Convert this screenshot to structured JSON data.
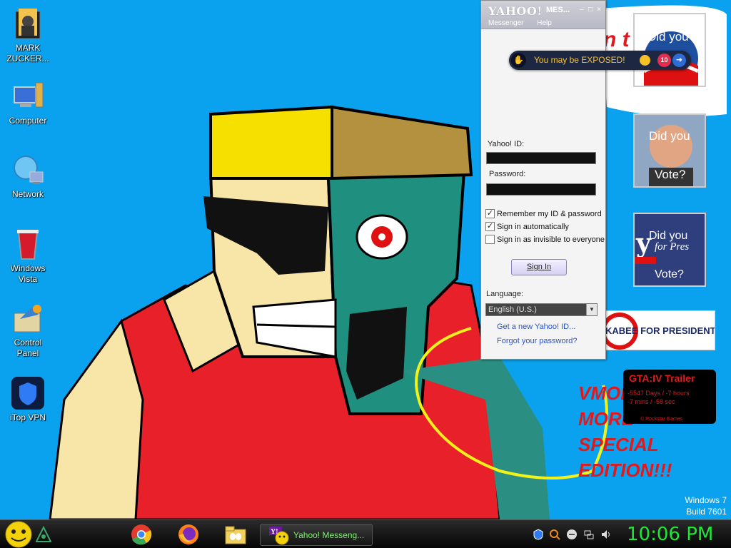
{
  "desktop_icons": [
    {
      "label": "MARK\nZUCKER...",
      "icon": "mark-zuckerberg-folder-icon"
    },
    {
      "label": "Computer",
      "icon": "computer-icon"
    },
    {
      "label": "Network",
      "icon": "network-globe-icon"
    },
    {
      "label": "Windows\nVista",
      "icon": "recycle-bin-icon"
    },
    {
      "label": "Control\nPanel",
      "icon": "control-panel-icon"
    },
    {
      "label": "iTop VPN",
      "icon": "itop-vpn-icon"
    }
  ],
  "gadgets": {
    "speech_fragment": "n t",
    "obama": {
      "text": "Did you"
    },
    "mccain": {
      "line1": "Did you",
      "line2": "Vote?"
    },
    "yahoo_vote": {
      "line1": "Did you",
      "line2": "for Pres",
      "line3": "Vote?"
    },
    "huckabee": {
      "text": "KABEE FOR PRESIDENT"
    },
    "gta": {
      "title": "GTA:IV Trailer",
      "line1": "-5547 Days / -7 hours",
      "line2": "-7 mins / -58 sec",
      "footer": "© Rockstar Games"
    },
    "vmod_text": [
      "VMOD",
      "MORE",
      "SPECIAL",
      "EDITION!!!"
    ]
  },
  "watermark": {
    "line1": "Windows 7",
    "line2": "Build 7601"
  },
  "yahoo_messenger": {
    "title": "YAHOO!",
    "title_suffix": "MES...",
    "menu": [
      "Messenger",
      "Help"
    ],
    "yahoo_id_label": "Yahoo! ID:",
    "yahoo_id_value": "",
    "password_label": "Password:",
    "password_value": "",
    "remember_label": "Remember my ID & password",
    "remember_checked": true,
    "auto_signin_label": "Sign in automatically",
    "auto_signin_checked": true,
    "invisible_label": "Sign in as invisible to everyone",
    "invisible_checked": false,
    "signin_button": "Sign In",
    "language_label": "Language:",
    "language_value": "English (U.S.)",
    "get_id_link": "Get a new Yahoo! ID...",
    "forgot_link": "Forgot your password?"
  },
  "toast": {
    "text": "You may be EXPOSED!",
    "count": "10"
  },
  "taskbar": {
    "yahoo_task_label": "Yahoo! Messeng...",
    "clock": "10:06 PM",
    "pinned": [
      "chrome-icon",
      "firefox-icon",
      "file-explorer-icon"
    ]
  },
  "colors": {
    "desktop_bg": "#0aa2ee",
    "clock": "#22e53a",
    "toast_text": "#f2c335",
    "link": "#2a53c5"
  }
}
